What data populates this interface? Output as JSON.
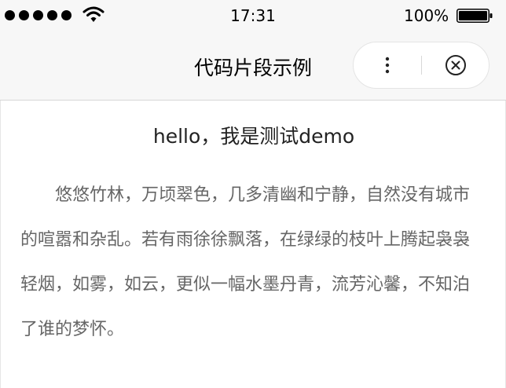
{
  "status_bar": {
    "time": "17:31",
    "battery_percent": "100%",
    "signal_icon": "signal-dots-icon",
    "wifi_icon": "wifi-icon",
    "battery_icon": "battery-full-icon"
  },
  "nav_bar": {
    "title": "代码片段示例",
    "more_icon": "more-vertical-icon",
    "close_icon": "close-circle-icon"
  },
  "content": {
    "heading": "hello，我是测试demo",
    "paragraph": "悠悠竹林，万顷翠色，几多清幽和宁静，自然没有城市的喧嚣和杂乱。若有雨徐徐飘落，在绿绿的枝叶上腾起袅袅轻烟，如雾，如云，更似一幅水墨丹青，流芳沁馨，不知泊了谁的梦怀。"
  },
  "colors": {
    "bar_background": "#f7f7f7",
    "heading_text": "#222222",
    "paragraph_text": "#666666"
  }
}
